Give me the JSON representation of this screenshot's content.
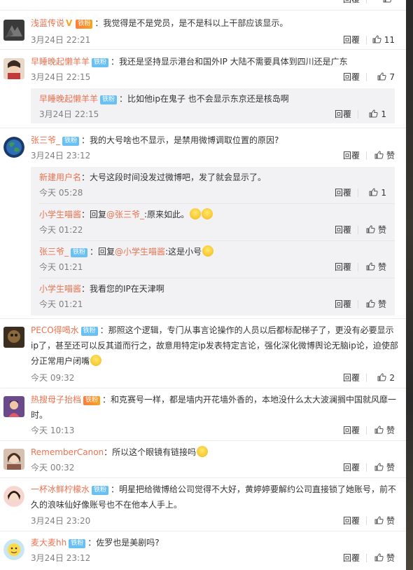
{
  "colors": {
    "username": "#eb7350",
    "badge": "#69c0f5",
    "meta": "#808080",
    "subbg": "#f2f2f5"
  },
  "top_partial": {
    "reply_label": "回覆",
    "like_count": ""
  },
  "comments": [
    {
      "user": "浅蓝传说",
      "vip": "V",
      "badge": "铁粉",
      "badge_style": "gold",
      "text": "：我觉得是不是党员，是不是科以上干部应该显示。",
      "time": "3月24日 22:21",
      "reply_label": "回覆",
      "like_count": "11"
    },
    {
      "user": "早睡晚起懒羊羊",
      "badge": "铁粉",
      "text": "：我还是坚持显示港台和国外IP 大陆不需要具体到四川还是广东",
      "time": "3月24日 22:15",
      "reply_label": "回覆",
      "like_count": "7",
      "replies": [
        {
          "user": "早睡晚起懒羊羊",
          "badge": "铁粉",
          "text": "：比如他ip在鬼子 也不会显示东京还是核岛啊",
          "time": "3月24日 22:15",
          "reply_label": "回覆",
          "like_count": "1"
        }
      ]
    },
    {
      "user": "张三爷_",
      "badge": "铁粉",
      "text": "：我的大号啥也不显示，是禁用微博调取位置的原因?",
      "time": "3月24日 23:12",
      "reply_label": "回覆",
      "like_count": "赞",
      "replies": [
        {
          "user": "新建用户名",
          "text": "：大号这段时间没发过微博吧，发了就会显示了。",
          "time": "今天 05:28",
          "reply_label": "回覆",
          "like_count": "1"
        },
        {
          "user": "小学生喵酱",
          "text_prefix": "：回复",
          "mention": "@张三爷_",
          "text": ":原来如此。",
          "time": "今天 01:22",
          "reply_label": "回覆",
          "like_count": "赞"
        },
        {
          "user": "张三爷_",
          "badge": "铁粉",
          "text_prefix": "：回复",
          "mention": "@小学生喵酱",
          "text": ":这是小号",
          "time": "今天 01:21",
          "reply_label": "回覆",
          "like_count": "赞"
        },
        {
          "user": "小学生喵酱",
          "text": "：我看您的IP在天津啊",
          "time": "今天 01:21",
          "reply_label": "回覆",
          "like_count": "赞"
        }
      ]
    },
    {
      "user": "PECO得喝水",
      "badge": "铁粉",
      "text": "：那照这个逻辑，专门从事言论操作的人员以后都标配梯子了，更没有必要显示ip了，甚至还可以反其道而行之，故意用特定ip发表特定言论，强化深化微博舆论无脑ip论，迫使部分正常用户闭嘴",
      "time": "今天 09:32",
      "reply_label": "回覆",
      "like_count": "2"
    },
    {
      "user": "热搜母子抬档",
      "badge": "铁粉",
      "badge_style": "gold",
      "text": "：和克赛号一样，都是墙内开花墙外香的，本地没什么太大波澜搁中国就风靡一时。",
      "time": "今天 10:13",
      "reply_label": "回覆",
      "like_count": "赞"
    },
    {
      "user": "RememberCanon",
      "text": "：所以这个眼镜有链接吗",
      "time": "今天 00:32",
      "reply_label": "回覆",
      "like_count": "赞"
    },
    {
      "user": "一杯冰鲜柠檬水",
      "badge": "铁粉",
      "text": "：明星把给微博给公司觉得不大好，黄婷婷要解约公司直接锁了她账号，前不久的浪味仙好像账号也不在他本人手上。",
      "time": "3月24日 23:20",
      "reply_label": "回覆",
      "like_count": "赞"
    },
    {
      "user": "麦大麦hh",
      "badge": "铁粉",
      "text": "：佐罗也是美剧吗?",
      "time": "3月24日 23:12",
      "reply_label": "回覆",
      "like_count": "赞"
    }
  ]
}
